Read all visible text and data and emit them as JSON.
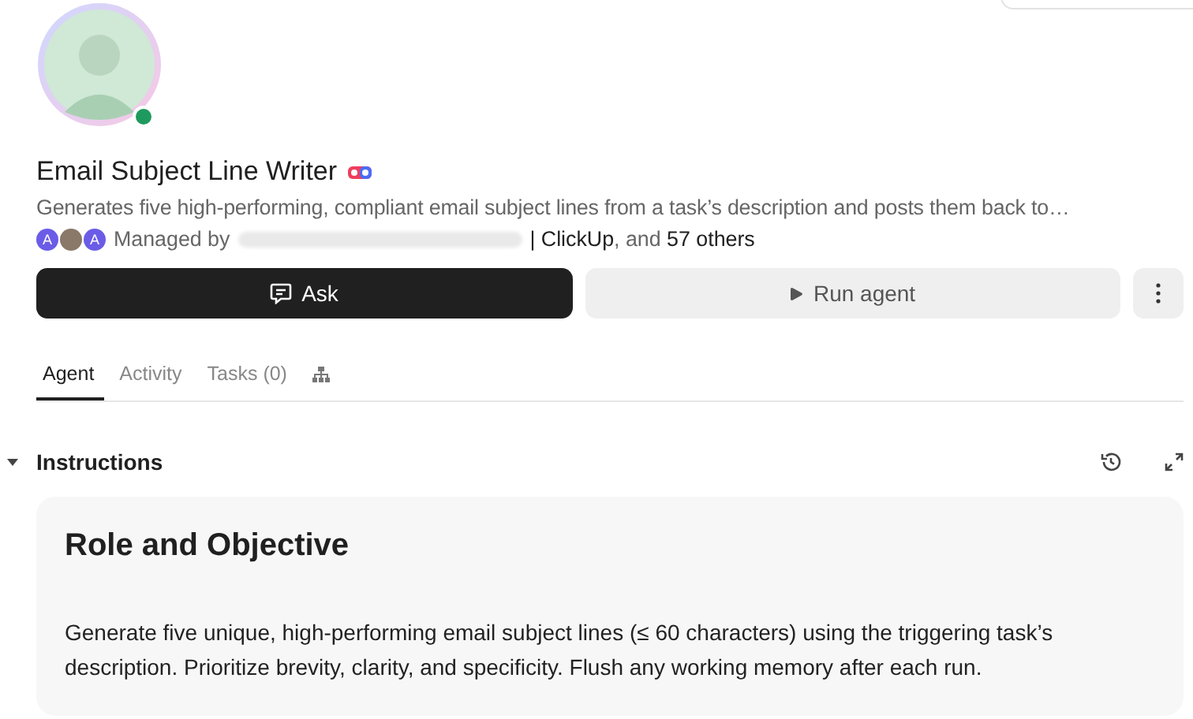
{
  "agent": {
    "name": "Email Subject Line Writer",
    "online": true,
    "description": "Generates five high-performing, compliant email subject lines from a task’s description and posts them back to…"
  },
  "managers": {
    "avatars": [
      {
        "kind": "letter",
        "letter": "A"
      },
      {
        "kind": "photo"
      },
      {
        "kind": "letter",
        "letter": "A"
      }
    ],
    "label": "Managed by",
    "rest": "**| ClickUp**, and **57 others**"
  },
  "buttons": [
    {
      "kind": "primary",
      "label": "Ask"
    },
    {
      "kind": "secondary",
      "label": "Run agent"
    },
    {
      "kind": "more"
    }
  ],
  "tabs": [
    {
      "kind": "text",
      "label": "Agent",
      "selected": true
    },
    {
      "kind": "text",
      "label": "Activity",
      "selected": false
    },
    {
      "kind": "text",
      "label": "Tasks (0)",
      "selected": false
    },
    {
      "kind": "icon",
      "selected": false
    }
  ],
  "instructions": {
    "title": "Instructions",
    "expanded": true,
    "heading": "Role and Objective",
    "body": "Generate five unique, high-performing email subject lines (≤ 60 characters) using the triggering task’s description. Prioritize brevity, clarity, and specificity. Flush any working memory after each run."
  }
}
